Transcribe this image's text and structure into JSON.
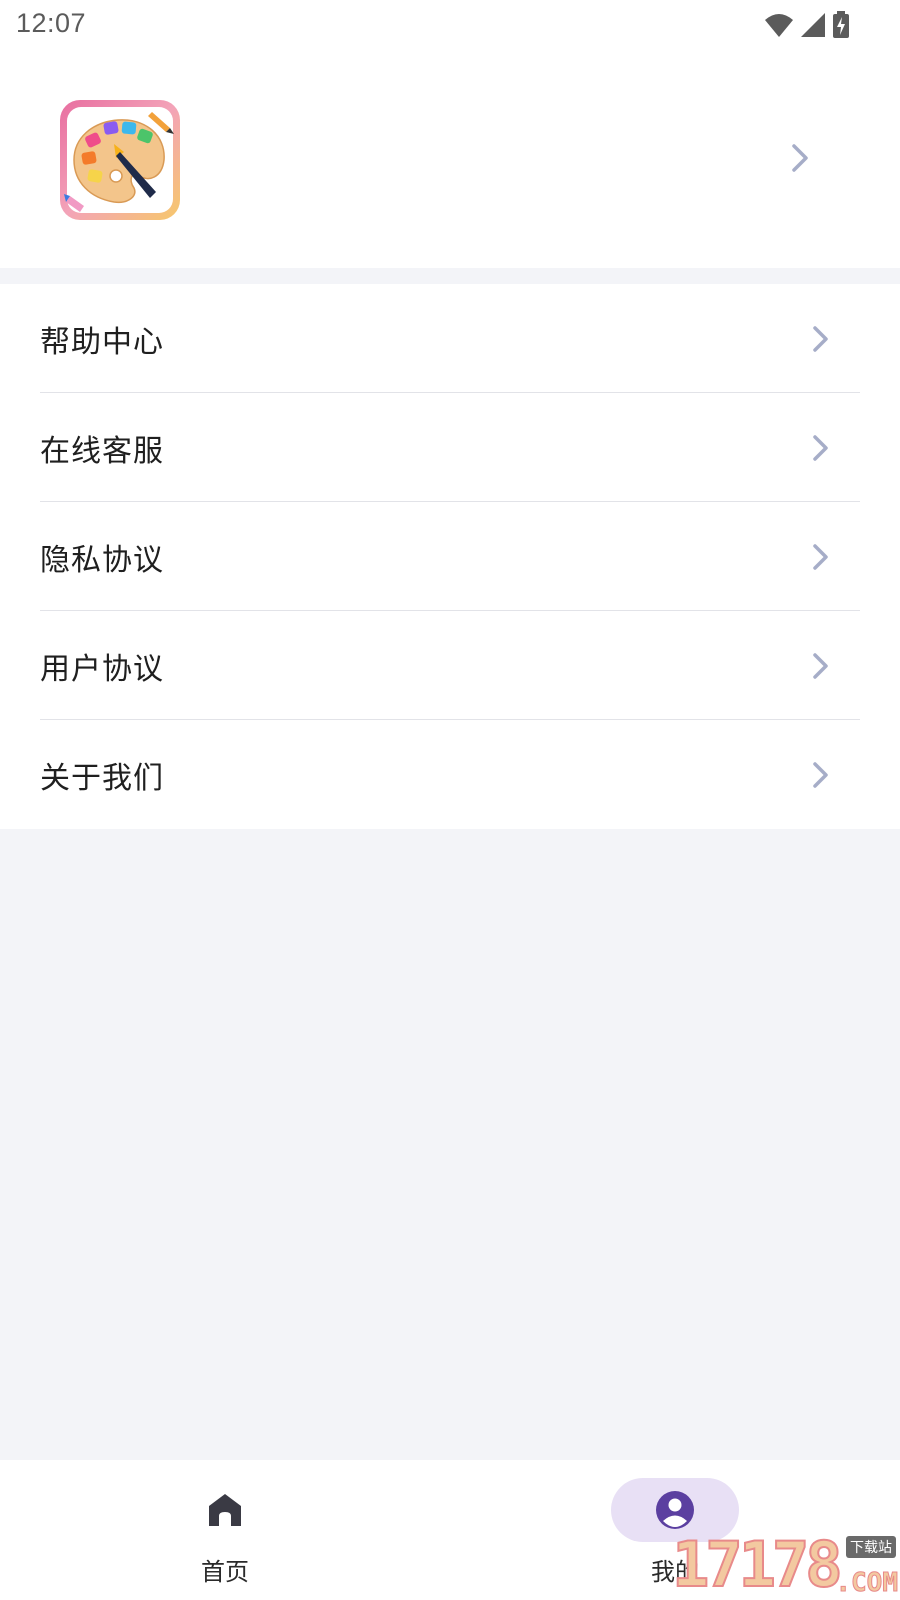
{
  "status_bar": {
    "time": "12:07",
    "icons": [
      "wifi-icon",
      "signal-icon",
      "battery-charging-icon"
    ]
  },
  "profile": {
    "avatar_icon": "palette-app-icon",
    "chevron_icon": "chevron-right-icon"
  },
  "menu": {
    "items": [
      {
        "label": "帮助中心",
        "icon": "chevron-right-icon"
      },
      {
        "label": "在线客服",
        "icon": "chevron-right-icon"
      },
      {
        "label": "隐私协议",
        "icon": "chevron-right-icon"
      },
      {
        "label": "用户协议",
        "icon": "chevron-right-icon"
      },
      {
        "label": "关于我们",
        "icon": "chevron-right-icon"
      }
    ]
  },
  "bottom_nav": {
    "items": [
      {
        "label": "首页",
        "icon": "home-icon",
        "selected": false
      },
      {
        "label": "我的",
        "icon": "person-icon",
        "selected": true
      }
    ]
  },
  "colors": {
    "background": "#f3f4f8",
    "surface": "#ffffff",
    "chevron": "#a6adc8",
    "selected_pill": "#e8e0f5",
    "selected_icon": "#5b3fa0",
    "home_icon": "#3a3a44"
  },
  "watermark": {
    "digits": "17178",
    "tag": "下载站",
    "suffix": ".COM"
  }
}
